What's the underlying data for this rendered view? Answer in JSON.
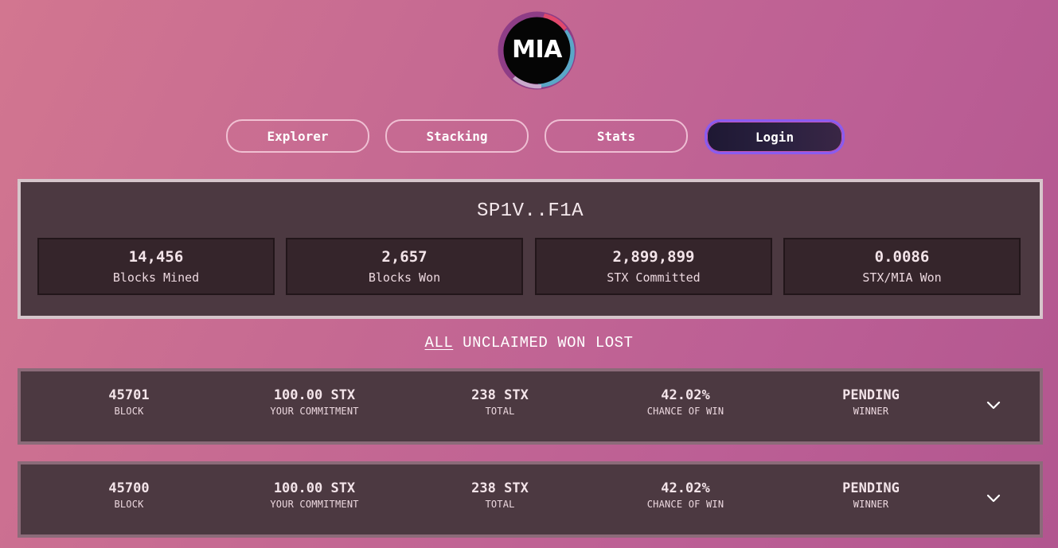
{
  "logo": {
    "text": "MIA"
  },
  "nav": {
    "explorer": "Explorer",
    "stacking": "Stacking",
    "stats": "Stats",
    "login": "Login"
  },
  "summary": {
    "address": "SP1V..F1A",
    "stats": [
      {
        "value": "14,456",
        "label": "Blocks Mined"
      },
      {
        "value": "2,657",
        "label": "Blocks Won"
      },
      {
        "value": "2,899,899",
        "label": "STX Committed"
      },
      {
        "value": "0.0086",
        "label": "STX/MIA Won"
      }
    ]
  },
  "filters": {
    "all": "ALL",
    "unclaimed": "UNCLAIMED",
    "won": "WON",
    "lost": "LOST",
    "active": "ALL"
  },
  "rows": [
    {
      "block": "45701",
      "block_label": "BLOCK",
      "commitment": "100.00 STX",
      "commitment_label": "YOUR COMMITMENT",
      "total": "238 STX",
      "total_label": "TOTAL",
      "chance": "42.02%",
      "chance_label": "CHANCE OF WIN",
      "winner": "PENDING",
      "winner_label": "WINNER"
    },
    {
      "block": "45700",
      "block_label": "BLOCK",
      "commitment": "100.00 STX",
      "commitment_label": "YOUR COMMITMENT",
      "total": "238 STX",
      "total_label": "TOTAL",
      "chance": "42.02%",
      "chance_label": "CHANCE OF WIN",
      "winner": "PENDING",
      "winner_label": "WINNER"
    }
  ],
  "icons": {
    "logo_ring": "logo-ring-icon",
    "expand": "chevron-down-icon"
  },
  "colors": {
    "panel": "#4c3941",
    "stat_box": "#35252b",
    "login_border": "#8a5cf0"
  }
}
